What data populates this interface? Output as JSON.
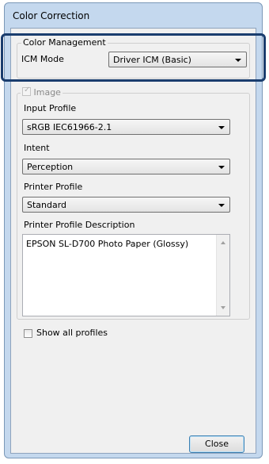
{
  "window": {
    "title": "Color Correction"
  },
  "color_management": {
    "group_label": "Color Management",
    "icm_mode_label": "ICM Mode",
    "icm_mode_value": "Driver ICM (Basic)"
  },
  "image": {
    "checkbox_label": "Image",
    "checked": true,
    "input_profile_label": "Input Profile",
    "input_profile_value": "sRGB IEC61966-2.1",
    "intent_label": "Intent",
    "intent_value": "Perception",
    "printer_profile_label": "Printer Profile",
    "printer_profile_value": "Standard",
    "printer_profile_description_label": "Printer Profile Description",
    "printer_profile_description_value": "EPSON SL-D700 Photo Paper (Glossy)"
  },
  "show_all_profiles": {
    "label": "Show all profiles",
    "checked": false
  },
  "buttons": {
    "close": "Close"
  },
  "colors": {
    "highlight": "#1a3d6e",
    "frame": "#c4d8ee"
  },
  "icons": {
    "dropdown": "chevron-down-icon",
    "check": "checkmark-icon"
  }
}
